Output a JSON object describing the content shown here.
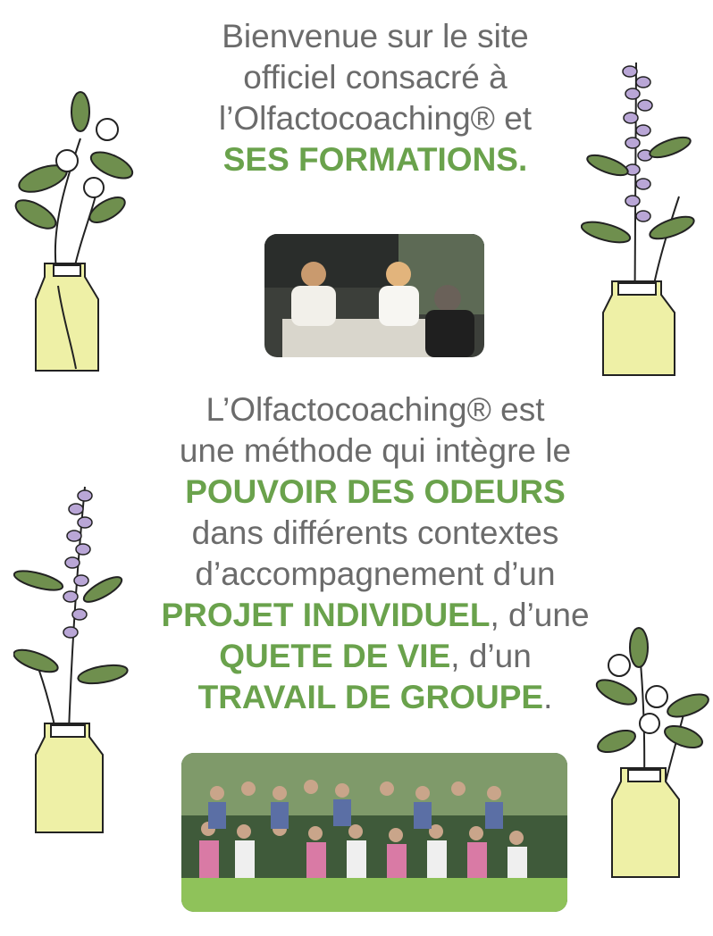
{
  "intro": {
    "line1": "Bienvenue sur le site",
    "line2": "officiel consacré à",
    "line3": "l’Olfactocoaching® et",
    "highlight": "SES FORMATIONS",
    "end": "."
  },
  "description": {
    "line1": "L’Olfactocoaching® est",
    "line2": "une méthode qui intègre le",
    "highlight1": "POUVOIR DES ODEURS",
    "line4": "dans différents contextes",
    "line5": "d’accompagnement d’un",
    "highlight2": "PROJET INDIVIDUEL",
    "after2": ", d’une",
    "highlight3": "QUETE DE VIE",
    "after3": ", d’un",
    "highlight4": "TRAVAIL DE GROUPE",
    "end": "."
  },
  "colors": {
    "text": "#6b6b6b",
    "accent_green": "#6aa24c",
    "jar": "#eef0a6",
    "lavender": "#b9a6d6",
    "leaf": "#6f8f4e"
  }
}
